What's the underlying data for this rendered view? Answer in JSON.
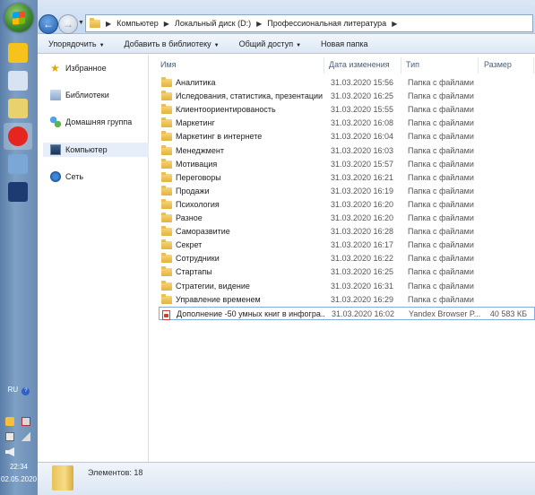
{
  "taskbar": {
    "pinned": [
      {
        "name": "sticky-notes-icon",
        "color": "#f6c21c"
      },
      {
        "name": "calculator-icon",
        "color": "#d7e3f1"
      },
      {
        "name": "control-panel-icon",
        "color": "#e9d26d"
      },
      {
        "name": "yandex-browser-icon",
        "color": "#e6251e"
      },
      {
        "name": "paint-icon",
        "color": "#7aa7d6"
      },
      {
        "name": "photoshop-icon",
        "color": "#1d3a73"
      }
    ],
    "tray": {
      "language": "RU",
      "time": "22:34",
      "date": "02.05.2020"
    }
  },
  "address": {
    "crumbs": [
      "Компьютер",
      "Локальный диск (D:)",
      "Профессиональная литература"
    ]
  },
  "toolbar": {
    "organize": "Упорядочить",
    "add_library": "Добавить в библиотеку",
    "share": "Общий доступ",
    "new_folder": "Новая папка"
  },
  "nav": {
    "favorites": "Избранное",
    "libraries": "Библиотеки",
    "homegroup": "Домашняя группа",
    "computer": "Компьютер",
    "network": "Сеть"
  },
  "columns": {
    "name": "Имя",
    "date": "Дата изменения",
    "type": "Тип",
    "size": "Размер"
  },
  "files": [
    {
      "name": "Аналитика",
      "date": "31.03.2020 15:56",
      "type": "Папка с файлами",
      "size": ""
    },
    {
      "name": "Иследования, статистика, презентации",
      "date": "31.03.2020 16:25",
      "type": "Папка с файлами",
      "size": ""
    },
    {
      "name": "Клиентоориентированость",
      "date": "31.03.2020 15:55",
      "type": "Папка с файлами",
      "size": ""
    },
    {
      "name": "Маркетинг",
      "date": "31.03.2020 16:08",
      "type": "Папка с файлами",
      "size": ""
    },
    {
      "name": "Маркетинг в интернете",
      "date": "31.03.2020 16:04",
      "type": "Папка с файлами",
      "size": ""
    },
    {
      "name": "Менеджмент",
      "date": "31.03.2020 16:03",
      "type": "Папка с файлами",
      "size": ""
    },
    {
      "name": "Мотивация",
      "date": "31.03.2020 15:57",
      "type": "Папка с файлами",
      "size": ""
    },
    {
      "name": "Переговоры",
      "date": "31.03.2020 16:21",
      "type": "Папка с файлами",
      "size": ""
    },
    {
      "name": "Продажи",
      "date": "31.03.2020 16:19",
      "type": "Папка с файлами",
      "size": ""
    },
    {
      "name": "Психология",
      "date": "31.03.2020 16:20",
      "type": "Папка с файлами",
      "size": ""
    },
    {
      "name": "Разное",
      "date": "31.03.2020 16:20",
      "type": "Папка с файлами",
      "size": ""
    },
    {
      "name": "Саморазвитие",
      "date": "31.03.2020 16:28",
      "type": "Папка с файлами",
      "size": ""
    },
    {
      "name": "Секрет",
      "date": "31.03.2020 16:17",
      "type": "Папка с файлами",
      "size": ""
    },
    {
      "name": "Сотрудники",
      "date": "31.03.2020 16:22",
      "type": "Папка с файлами",
      "size": ""
    },
    {
      "name": "Стартапы",
      "date": "31.03.2020 16:25",
      "type": "Папка с файлами",
      "size": ""
    },
    {
      "name": "Стратегии, видение",
      "date": "31.03.2020 16:31",
      "type": "Папка с файлами",
      "size": ""
    },
    {
      "name": "Управление временем",
      "date": "31.03.2020 16:29",
      "type": "Папка с файлами",
      "size": ""
    },
    {
      "name": "Дополнение -50 умных книг в инфогра...",
      "date": "31.03.2020 16:02",
      "type": "Yandex Browser P...",
      "size": "40 583 КБ",
      "pdf": true,
      "selected": true
    }
  ],
  "status": {
    "count_text": "Элементов: 18"
  }
}
